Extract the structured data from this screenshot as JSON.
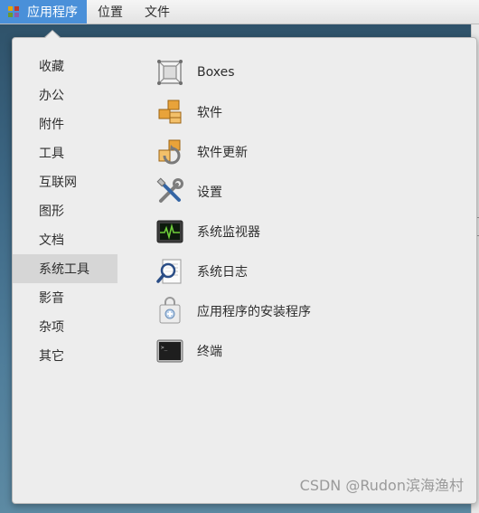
{
  "topbar": {
    "menus": [
      {
        "label": "应用程序",
        "active": true
      },
      {
        "label": "位置",
        "active": false
      },
      {
        "label": "文件",
        "active": false
      }
    ]
  },
  "categories": [
    "收藏",
    "办公",
    "附件",
    "工具",
    "互联网",
    "图形",
    "文档",
    "系统工具",
    "影音",
    "杂项",
    "其它"
  ],
  "selected_category": "系统工具",
  "apps": [
    {
      "label": "Boxes",
      "icon": "boxes-icon"
    },
    {
      "label": "软件",
      "icon": "software-icon"
    },
    {
      "label": "软件更新",
      "icon": "software-update-icon"
    },
    {
      "label": "设置",
      "icon": "settings-icon"
    },
    {
      "label": "系统监视器",
      "icon": "system-monitor-icon"
    },
    {
      "label": "系统日志",
      "icon": "system-log-icon"
    },
    {
      "label": "应用程序的安装程序",
      "icon": "app-installer-icon"
    },
    {
      "label": "终端",
      "icon": "terminal-icon"
    }
  ],
  "watermark": "CSDN @Rudon滨海渔村",
  "colors": {
    "accent": "#4a90d9",
    "selected_bg": "#d6d6d6",
    "popover_bg": "#ededed"
  }
}
